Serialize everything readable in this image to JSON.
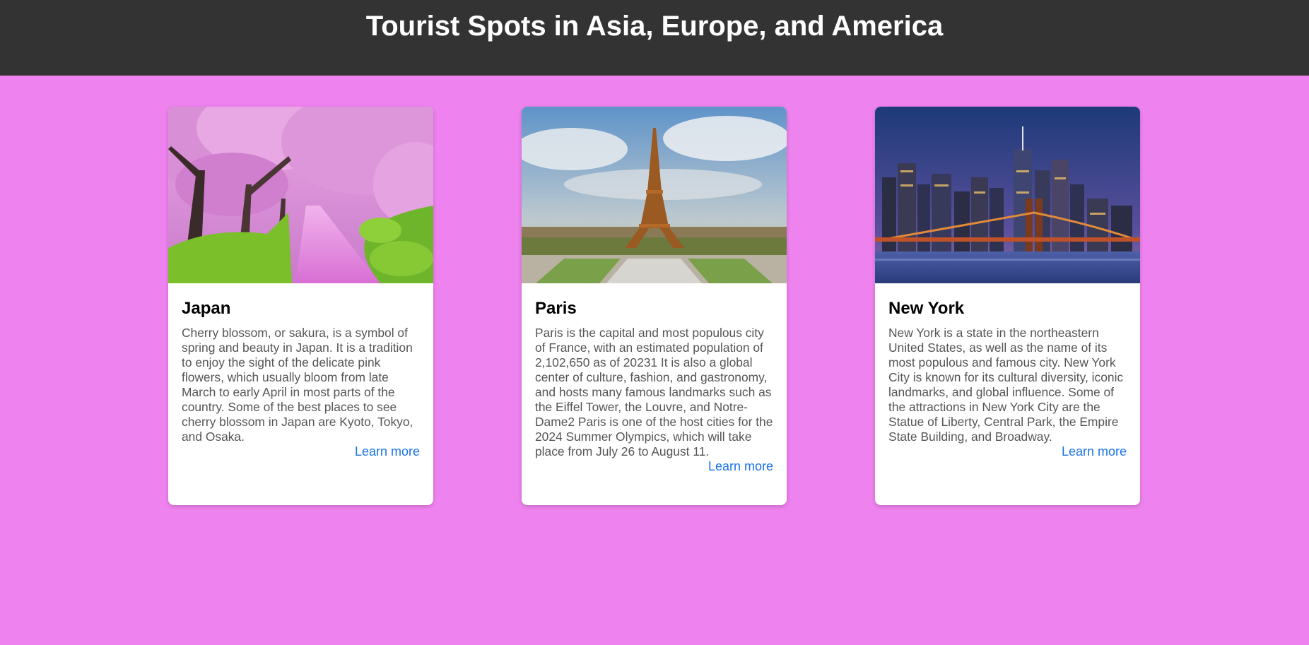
{
  "header": {
    "title": "Tourist Spots in Asia, Europe, and America"
  },
  "colors": {
    "page_bg": "#ee82ee",
    "header_bg": "#333333",
    "link": "#1a73e8"
  },
  "cards": [
    {
      "title": "Japan",
      "image": "cherry-blossom-path-photo",
      "description": "Cherry blossom, or sakura, is a symbol of spring and beauty in Japan. It is a tradition to enjoy the sight of the delicate pink flowers, which usually bloom from late March to early April in most parts of the country. Some of the best places to see cherry blossom in Japan are Kyoto, Tokyo, and Osaka.",
      "link": "Learn more"
    },
    {
      "title": "Paris",
      "image": "eiffel-tower-photo",
      "description": "Paris is the capital and most populous city of France, with an estimated population of 2,102,650 as of 20231 It is also a global center of culture, fashion, and gastronomy, and hosts many famous landmarks such as the Eiffel Tower, the Louvre, and Notre-Dame2 Paris is one of the host cities for the 2024 Summer Olympics, which will take place from July 26 to August 11.",
      "link": "Learn more"
    },
    {
      "title": "New York",
      "image": "manhattan-skyline-night-photo",
      "description": "New York is a state in the northeastern United States, as well as the name of its most populous and famous city. New York City is known for its cultural diversity, iconic landmarks, and global influence. Some of the attractions in New York City are the Statue of Liberty, Central Park, the Empire State Building, and Broadway.",
      "link": "Learn more"
    }
  ]
}
